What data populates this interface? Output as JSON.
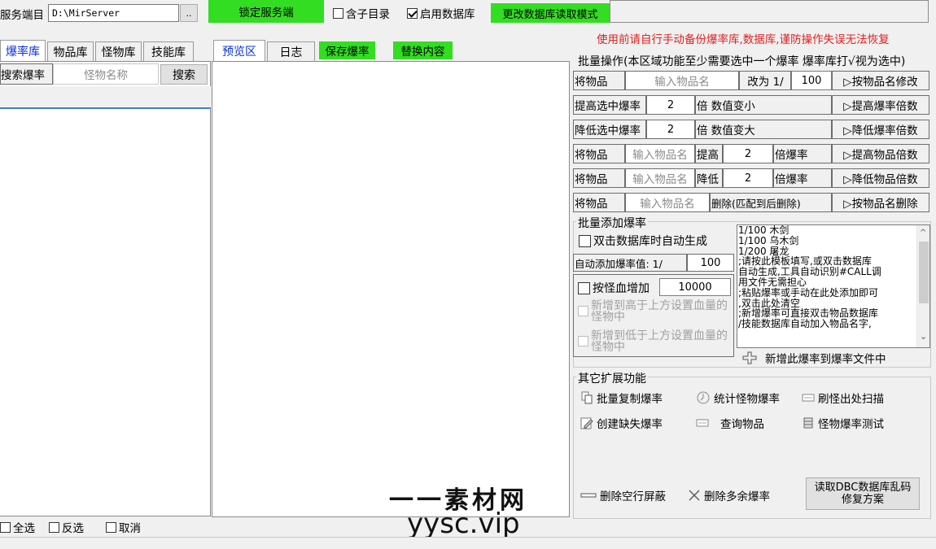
{
  "server": {
    "label": "服务端目",
    "path": "D:\\MirServer",
    "browse": "..",
    "lock_button": "锁定服务端",
    "include_subdir": "含子目录",
    "enable_db": "启用数据库",
    "change_db_mode": "更改数据库读取模式"
  },
  "warning": "使用前请自行手动备份爆率库,数据库,谨防操作失误无法恢复",
  "left_tabs": [
    "爆率库",
    "物品库",
    "怪物库",
    "技能库"
  ],
  "search": {
    "label": "搜索爆率",
    "placeholder": "怪物名称",
    "button": "搜索"
  },
  "bottom_checks": [
    "全选",
    "反选",
    "取消"
  ],
  "mid_tabs": {
    "preview": "预览区",
    "log": "日志",
    "save": "保存爆率",
    "replace": "替换内容"
  },
  "batch": {
    "header": "批量操作(本区域功能至少需要选中一个爆率 爆率库打√视为选中)",
    "row1": {
      "label": "将物品",
      "placeholder": "输入物品名",
      "mid": "改为 1/",
      "value": "100",
      "action": "▷按物品名修改"
    },
    "row2": {
      "label": "提高选中爆率",
      "value": "2",
      "mid": "倍 数值变小",
      "action": "▷提高爆率倍数"
    },
    "row3": {
      "label": "降低选中爆率",
      "value": "2",
      "mid": "倍 数值变大",
      "action": "▷降低爆率倍数"
    },
    "row4": {
      "label": "将物品",
      "placeholder": "输入物品名",
      "mid": "提高",
      "value": "2",
      "suffix": "倍爆率",
      "action": "▷提高物品倍数"
    },
    "row5": {
      "label": "将物品",
      "placeholder": "输入物品名",
      "mid": "降低",
      "value": "2",
      "suffix": "倍爆率",
      "action": "▷降低物品倍数"
    },
    "row6": {
      "label": "将物品",
      "placeholder": "输入物品名",
      "mid": "删除(匹配到后删除)",
      "action": "▷按物品名删除"
    }
  },
  "add": {
    "title": "批量添加爆率",
    "auto_gen": "双击数据库时自动生成",
    "auto_val_label": "自动添加爆率值: 1/",
    "auto_val": "100",
    "by_hp": "按怪血增加",
    "hp_value": "10000",
    "higher": "新增到高于上方设置血量的怪物中",
    "lower": "新增到低于上方设置血量的怪物中",
    "template_lines": [
      "1/100 木剑",
      "1/100 乌木剑",
      "1/200 屠龙",
      ";请按此模板填写,或双击数据库",
      "自动生成,工具自动识别#CALL调",
      "用文件无需担心",
      ";粘贴爆率或手动在此处添加即可",
      ",双击此处清空",
      ";新增爆率可直接双击物品数据库",
      "/技能数据库自动加入物品名字,"
    ],
    "add_button": "新增此爆率到爆率文件中"
  },
  "ext": {
    "title": "其它扩展功能",
    "batch_copy": "批量复制爆率",
    "stat_monster": "统计怪物爆率",
    "refresh_scan": "刷怪出处扫描",
    "create_missing": "创建缺失爆率",
    "query_item": "查询物品",
    "monster_test": "怪物爆率测试",
    "delete_blank": "删除空行屏蔽",
    "delete_extra": "删除多余爆率",
    "dbc_fix": "读取DBC数据库乱码修复方案"
  },
  "watermark": {
    "cn": "一一素材网",
    "url": "yysc.vip"
  },
  "colors": {
    "green": "#33dd22",
    "warning_red": "#e02020",
    "active_tab_blue": "#0a2fd8"
  }
}
